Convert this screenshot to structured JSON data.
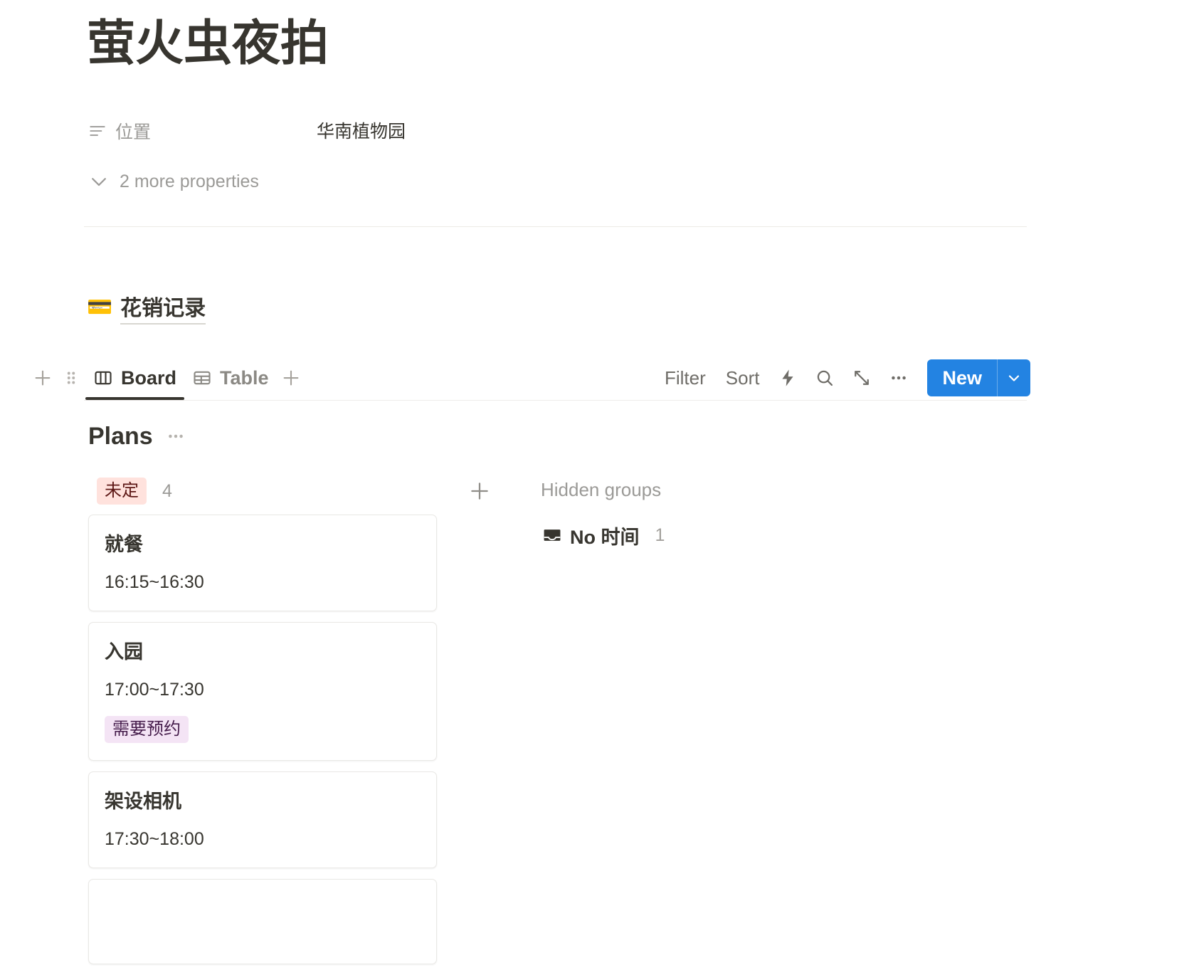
{
  "page": {
    "title": "萤火虫夜拍",
    "properties": [
      {
        "icon": "text-lines-icon",
        "label": "位置",
        "value": "华南植物园"
      }
    ],
    "more_properties_label": "2 more properties"
  },
  "database": {
    "emoji": "💳",
    "emoji_name": "credit-card-icon",
    "name": "花销记录",
    "toolbar": {
      "add_block_icon": "plus-icon",
      "drag_handle_icon": "drag-dots-icon",
      "views": [
        {
          "label": "Board",
          "icon": "board-icon",
          "active": true
        },
        {
          "label": "Table",
          "icon": "table-icon",
          "active": false
        }
      ],
      "add_view_icon": "plus-icon",
      "filter_label": "Filter",
      "sort_label": "Sort",
      "automation_icon": "lightning-icon",
      "search_icon": "search-icon",
      "expand_icon": "expand-arrows-icon",
      "more_icon": "ellipsis-icon",
      "new_label": "New",
      "new_dropdown_icon": "chevron-down-icon"
    },
    "board": {
      "name": "Plans",
      "more_icon": "ellipsis-icon",
      "groups": [
        {
          "chip_label": "未定",
          "chip_color": "#ffe2dd",
          "chip_text_color": "#5d1715",
          "count": "4",
          "cards": [
            {
              "title": "就餐",
              "time": "16:15~16:30",
              "tags": []
            },
            {
              "title": "入园",
              "time": "17:00~17:30",
              "tags": [
                "需要预约"
              ]
            },
            {
              "title": "架设相机",
              "time": "17:30~18:00",
              "tags": []
            },
            {
              "title": "",
              "time": "",
              "tags": []
            }
          ]
        }
      ],
      "add_group_icon": "plus-icon",
      "hidden_groups_label": "Hidden groups",
      "hidden_groups": [
        {
          "icon": "inbox-icon",
          "name": "No 时间",
          "count": "1"
        }
      ]
    }
  },
  "colors": {
    "accent_blue": "#2383e2",
    "text_primary": "#37352f",
    "text_muted": "#9b9a97",
    "chip_pink": "#ffe2dd",
    "chip_purple": "#f4e4f5"
  }
}
